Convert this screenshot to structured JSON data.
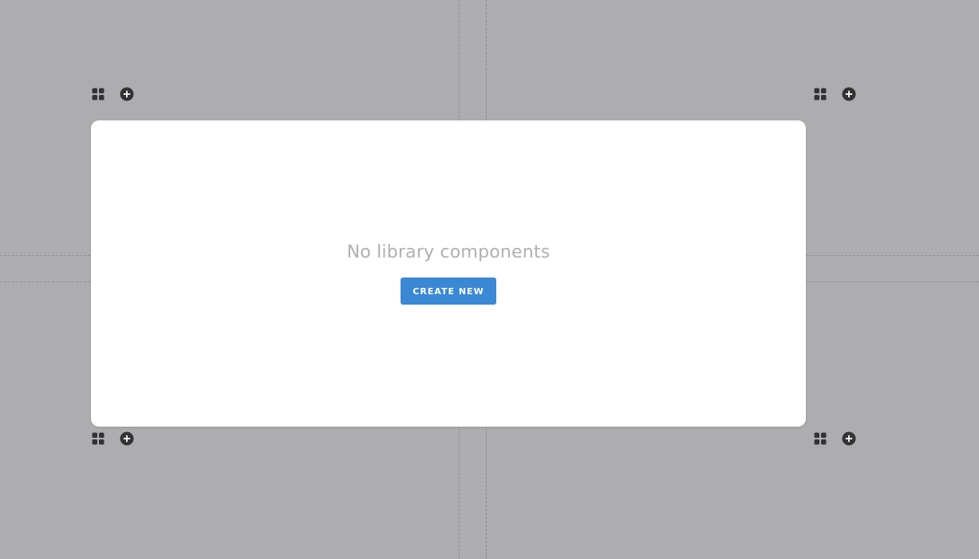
{
  "canvas": {
    "background": "#adadaf",
    "guide_color": "#8f8f92"
  },
  "toolbars": [
    {
      "id": "top-left",
      "icons": [
        "grid-icon",
        "plus-circle-icon"
      ]
    },
    {
      "id": "top-right",
      "icons": [
        "grid-icon",
        "plus-circle-icon"
      ]
    },
    {
      "id": "bottom-left",
      "icons": [
        "grid-icon",
        "plus-circle-icon"
      ]
    },
    {
      "id": "bottom-right",
      "icons": [
        "grid-icon",
        "plus-circle-icon"
      ]
    }
  ],
  "library_panel": {
    "empty_message": "No library components",
    "create_button_label": "CREATE NEW",
    "button_color": "#3a88d4",
    "message_color": "#b0b0b3"
  }
}
